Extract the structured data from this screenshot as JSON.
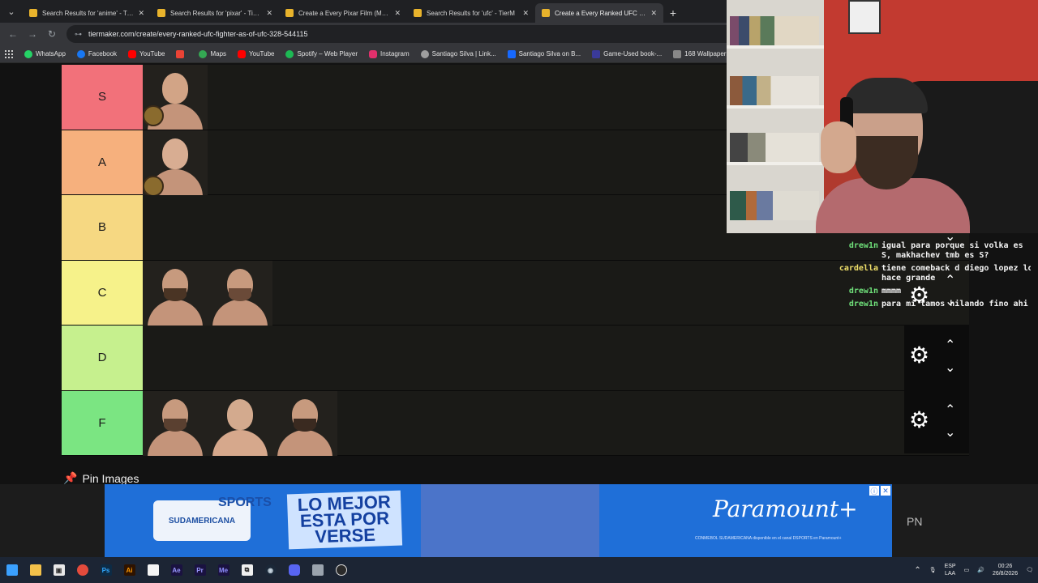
{
  "browser": {
    "tabs": [
      {
        "title": "Search Results for 'anime' - Tier",
        "active": false
      },
      {
        "title": "Search Results for 'pixar' - TierM",
        "active": false
      },
      {
        "title": "Create a Every Pixar Film (Marc",
        "active": false
      },
      {
        "title": "Search Results for 'ufc' - TierM",
        "active": false
      },
      {
        "title": "Create a Every Ranked UFC Figh",
        "active": true
      }
    ],
    "new_tab_icon": "+",
    "url": "tiermaker.com/create/every-ranked-ufc-fighter-as-of-ufc-328-544115",
    "bookmarks": [
      {
        "label": "WhatsApp",
        "color": "#25d366"
      },
      {
        "label": "Facebook",
        "color": "#1877f2"
      },
      {
        "label": "YouTube",
        "color": "#ff0000"
      },
      {
        "label": "",
        "color": "#ea4335"
      },
      {
        "label": "Maps",
        "color": "#34a853"
      },
      {
        "label": "YouTube",
        "color": "#ff0000"
      },
      {
        "label": "Spotify – Web Player",
        "color": "#1db954"
      },
      {
        "label": "Instagram",
        "color": "#e1306c"
      },
      {
        "label": "Santiago Silva | Link...",
        "color": "#9e9e9e"
      },
      {
        "label": "Santiago Silva on B...",
        "color": "#1769ff"
      },
      {
        "label": "Game-Used book-...",
        "color": "#3a3a9a"
      },
      {
        "label": "168 Wallpapers by...",
        "color": "#888888"
      }
    ]
  },
  "tiers": [
    {
      "label": "S",
      "color": "#f2717a",
      "fighters": 1,
      "belt": true
    },
    {
      "label": "A",
      "color": "#f6b07d",
      "fighters": 1,
      "belt": true
    },
    {
      "label": "B",
      "color": "#f6d882",
      "fighters": 0,
      "belt": false
    },
    {
      "label": "C",
      "color": "#f6f28a",
      "fighters": 2,
      "belt": false
    },
    {
      "label": "D",
      "color": "#c6f08e",
      "fighters": 0,
      "belt": false
    },
    {
      "label": "F",
      "color": "#7be582",
      "fighters": 3,
      "belt": false
    }
  ],
  "chat": [
    {
      "user": "drew1n",
      "color": "green",
      "msg": "igual para porque si volka es S, makhachev tmb es S?"
    },
    {
      "user": "cardella",
      "color": "yellow",
      "msg": "tiene comeback d diego lopez lo hace grande"
    },
    {
      "user": "drew1n",
      "color": "green",
      "msg": "mmmm"
    },
    {
      "user": "drew1n",
      "color": "green",
      "msg": "para mi tamos hilando fino ahi"
    }
  ],
  "pin_images": {
    "label": "Pin Images",
    "icon": "pin-icon"
  },
  "ad": {
    "brand_left": "SPORTS",
    "brand_sub": "SUDAMERICANA",
    "headline": "LO MEJOR ESTA POR VERSE",
    "brand_right": "Paramount+",
    "fineprint": "CONMEBOL SUDAMERICANA disponible en el canal DSPORTS en Paramount+",
    "side_text": "PN"
  },
  "taskbar": {
    "lang": "ESP",
    "region": "LAA",
    "time": "00:26",
    "date": "26/8/2026"
  }
}
